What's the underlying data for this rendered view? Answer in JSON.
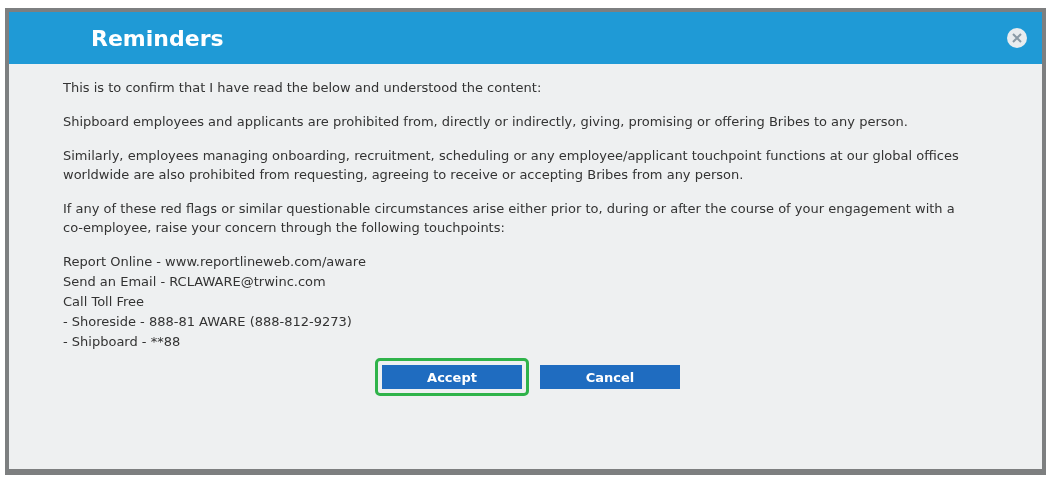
{
  "dialog": {
    "title": "Reminders",
    "paragraphs": [
      "This is to confirm that I have read the below and understood the content:",
      "Shipboard employees and applicants are prohibited from, directly or indirectly, giving, promising or offering Bribes to any person.",
      "Similarly, employees managing onboarding, recruitment, scheduling or any employee/applicant touchpoint functions at our global offices worldwide are also prohibited from requesting, agreeing to receive or accepting Bribes from any person.",
      "If any of these red flags or similar questionable circumstances arise either prior to, during or after the course of your engagement with a co-employee, raise your concern through the following touchpoints:"
    ],
    "contacts": [
      "Report Online - www.reportlineweb.com/aware",
      "Send an Email - RCLAWARE@trwinc.com",
      "Call Toll Free",
      "- Shoreside - 888-81 AWARE (888-812-9273)",
      "- Shipboard - **88"
    ],
    "buttons": [
      {
        "label": "Accept",
        "highlighted": true
      },
      {
        "label": "Cancel",
        "highlighted": false
      }
    ]
  }
}
